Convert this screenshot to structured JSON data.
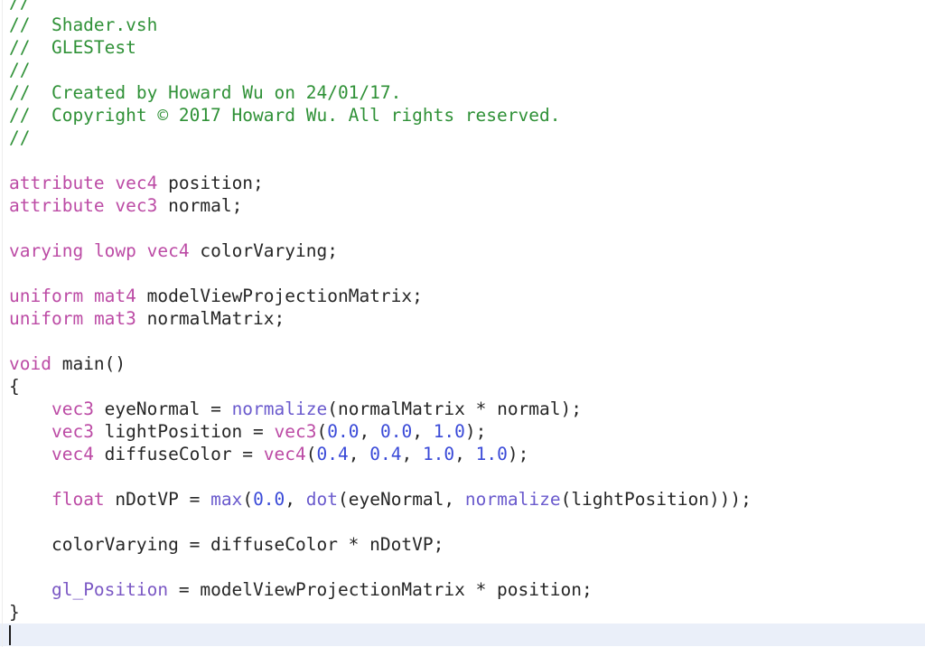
{
  "editor": {
    "name": "source-code-editor",
    "filename": "Shader.vsh",
    "language": "GLSL",
    "background_color": "#ffffff",
    "current_line_highlight_color": "#eaeff9",
    "caret_color": "#1a1a1a",
    "gutter_rule_color": "#ededed"
  },
  "theme": {
    "comment_color": "#2f9137",
    "keyword_color": "#bc4ba5",
    "function_color": "#6a5acd",
    "number_color": "#3a4ad8",
    "builtin_variable_color": "#7b58c4",
    "plain_color": "#262626"
  },
  "code_lines": [
    {
      "id": "line-1",
      "tokens": [
        {
          "t": "//",
          "c": "cmt"
        }
      ]
    },
    {
      "id": "line-2",
      "tokens": [
        {
          "t": "//  Shader.vsh",
          "c": "cmt"
        }
      ]
    },
    {
      "id": "line-3",
      "tokens": [
        {
          "t": "//  GLESTest",
          "c": "cmt"
        }
      ]
    },
    {
      "id": "line-4",
      "tokens": [
        {
          "t": "//",
          "c": "cmt"
        }
      ]
    },
    {
      "id": "line-5",
      "tokens": [
        {
          "t": "//  Created by Howard Wu on 24/01/17.",
          "c": "cmt"
        }
      ]
    },
    {
      "id": "line-6",
      "tokens": [
        {
          "t": "//  Copyright © 2017 Howard Wu. All rights reserved.",
          "c": "cmt"
        }
      ]
    },
    {
      "id": "line-7",
      "tokens": [
        {
          "t": "//",
          "c": "cmt"
        }
      ]
    },
    {
      "id": "line-8",
      "tokens": []
    },
    {
      "id": "line-9",
      "tokens": [
        {
          "t": "attribute",
          "c": "kw"
        },
        {
          "t": " ",
          "c": "pln"
        },
        {
          "t": "vec4",
          "c": "kw"
        },
        {
          "t": " position;",
          "c": "pln"
        }
      ]
    },
    {
      "id": "line-10",
      "tokens": [
        {
          "t": "attribute",
          "c": "kw"
        },
        {
          "t": " ",
          "c": "pln"
        },
        {
          "t": "vec3",
          "c": "kw"
        },
        {
          "t": " normal;",
          "c": "pln"
        }
      ]
    },
    {
      "id": "line-11",
      "tokens": []
    },
    {
      "id": "line-12",
      "tokens": [
        {
          "t": "varying",
          "c": "kw"
        },
        {
          "t": " ",
          "c": "pln"
        },
        {
          "t": "lowp",
          "c": "kw"
        },
        {
          "t": " ",
          "c": "pln"
        },
        {
          "t": "vec4",
          "c": "kw"
        },
        {
          "t": " colorVarying;",
          "c": "pln"
        }
      ]
    },
    {
      "id": "line-13",
      "tokens": []
    },
    {
      "id": "line-14",
      "tokens": [
        {
          "t": "uniform",
          "c": "kw"
        },
        {
          "t": " ",
          "c": "pln"
        },
        {
          "t": "mat4",
          "c": "kw"
        },
        {
          "t": " modelViewProjectionMatrix;",
          "c": "pln"
        }
      ]
    },
    {
      "id": "line-15",
      "tokens": [
        {
          "t": "uniform",
          "c": "kw"
        },
        {
          "t": " ",
          "c": "pln"
        },
        {
          "t": "mat3",
          "c": "kw"
        },
        {
          "t": " normalMatrix;",
          "c": "pln"
        }
      ]
    },
    {
      "id": "line-16",
      "tokens": []
    },
    {
      "id": "line-17",
      "tokens": [
        {
          "t": "void",
          "c": "kw"
        },
        {
          "t": " main()",
          "c": "pln"
        }
      ]
    },
    {
      "id": "line-18",
      "tokens": [
        {
          "t": "{",
          "c": "pln"
        }
      ]
    },
    {
      "id": "line-19",
      "tokens": [
        {
          "t": "    ",
          "c": "pln"
        },
        {
          "t": "vec3",
          "c": "kw"
        },
        {
          "t": " eyeNormal = ",
          "c": "pln"
        },
        {
          "t": "normalize",
          "c": "fn"
        },
        {
          "t": "(normalMatrix * normal);",
          "c": "pln"
        }
      ]
    },
    {
      "id": "line-20",
      "tokens": [
        {
          "t": "    ",
          "c": "pln"
        },
        {
          "t": "vec3",
          "c": "kw"
        },
        {
          "t": " lightPosition = ",
          "c": "pln"
        },
        {
          "t": "vec3",
          "c": "kw"
        },
        {
          "t": "(",
          "c": "pln"
        },
        {
          "t": "0.0",
          "c": "num"
        },
        {
          "t": ", ",
          "c": "pln"
        },
        {
          "t": "0.0",
          "c": "num"
        },
        {
          "t": ", ",
          "c": "pln"
        },
        {
          "t": "1.0",
          "c": "num"
        },
        {
          "t": ");",
          "c": "pln"
        }
      ]
    },
    {
      "id": "line-21",
      "tokens": [
        {
          "t": "    ",
          "c": "pln"
        },
        {
          "t": "vec4",
          "c": "kw"
        },
        {
          "t": " diffuseColor = ",
          "c": "pln"
        },
        {
          "t": "vec4",
          "c": "kw"
        },
        {
          "t": "(",
          "c": "pln"
        },
        {
          "t": "0.4",
          "c": "num"
        },
        {
          "t": ", ",
          "c": "pln"
        },
        {
          "t": "0.4",
          "c": "num"
        },
        {
          "t": ", ",
          "c": "pln"
        },
        {
          "t": "1.0",
          "c": "num"
        },
        {
          "t": ", ",
          "c": "pln"
        },
        {
          "t": "1.0",
          "c": "num"
        },
        {
          "t": ");",
          "c": "pln"
        }
      ]
    },
    {
      "id": "line-22",
      "tokens": []
    },
    {
      "id": "line-23",
      "tokens": [
        {
          "t": "    ",
          "c": "pln"
        },
        {
          "t": "float",
          "c": "kw"
        },
        {
          "t": " nDotVP = ",
          "c": "pln"
        },
        {
          "t": "max",
          "c": "fn"
        },
        {
          "t": "(",
          "c": "pln"
        },
        {
          "t": "0.0",
          "c": "num"
        },
        {
          "t": ", ",
          "c": "pln"
        },
        {
          "t": "dot",
          "c": "fn"
        },
        {
          "t": "(eyeNormal, ",
          "c": "pln"
        },
        {
          "t": "normalize",
          "c": "fn"
        },
        {
          "t": "(lightPosition)));",
          "c": "pln"
        }
      ]
    },
    {
      "id": "line-24",
      "tokens": []
    },
    {
      "id": "line-25",
      "tokens": [
        {
          "t": "    colorVarying = diffuseColor * nDotVP;",
          "c": "pln"
        }
      ]
    },
    {
      "id": "line-26",
      "tokens": []
    },
    {
      "id": "line-27",
      "tokens": [
        {
          "t": "    ",
          "c": "pln"
        },
        {
          "t": "gl_Position",
          "c": "bvar"
        },
        {
          "t": " = modelViewProjectionMatrix * position;",
          "c": "pln"
        }
      ]
    },
    {
      "id": "line-28",
      "tokens": [
        {
          "t": "}",
          "c": "pln"
        }
      ]
    },
    {
      "id": "line-29",
      "tokens": [],
      "current": true,
      "caret": true
    }
  ]
}
